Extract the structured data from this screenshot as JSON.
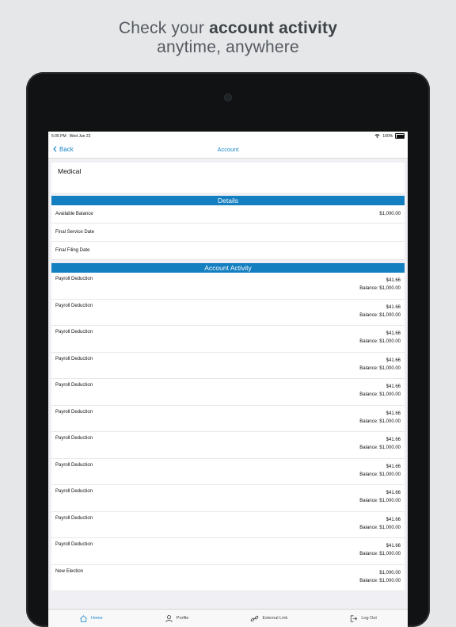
{
  "headline": {
    "line1_prefix": "Check your ",
    "line1_bold": "account activity",
    "line2": "anytime, anywhere"
  },
  "status_bar": {
    "time_date": "5:05 PM   Wed Jun 22",
    "battery": "100%"
  },
  "nav": {
    "back_label": "Back",
    "title": "Account"
  },
  "account": {
    "name": "Medical"
  },
  "details": {
    "header": "Details",
    "rows": [
      {
        "label": "Available Balance",
        "value": "$1,000.00"
      },
      {
        "label": "Final Service Date",
        "value": ""
      },
      {
        "label": "Final Filing Date",
        "value": ""
      }
    ]
  },
  "activity": {
    "header": "Account Activity",
    "rows": [
      {
        "label": "Payroll Deduction",
        "amount": "$41.66",
        "balance": "Balance: $1,000.00"
      },
      {
        "label": "Payroll Deduction",
        "amount": "$41.66",
        "balance": "Balance: $1,000.00"
      },
      {
        "label": "Payroll Deduction",
        "amount": "$41.66",
        "balance": "Balance: $1,000.00"
      },
      {
        "label": "Payroll Deduction",
        "amount": "$41.66",
        "balance": "Balance: $1,000.00"
      },
      {
        "label": "Payroll Deduction",
        "amount": "$41.66",
        "balance": "Balance: $1,000.00"
      },
      {
        "label": "Payroll Deduction",
        "amount": "$41.66",
        "balance": "Balance: $1,000.00"
      },
      {
        "label": "Payroll Deduction",
        "amount": "$41.66",
        "balance": "Balance: $1,000.00"
      },
      {
        "label": "Payroll Deduction",
        "amount": "$41.66",
        "balance": "Balance: $1,000.00"
      },
      {
        "label": "Payroll Deduction",
        "amount": "$41.66",
        "balance": "Balance: $1,000.00"
      },
      {
        "label": "Payroll Deduction",
        "amount": "$41.66",
        "balance": "Balance: $1,000.00"
      },
      {
        "label": "Payroll Deduction",
        "amount": "$41.66",
        "balance": "Balance: $1,000.00"
      },
      {
        "label": "New Election",
        "amount": "$1,000.00",
        "balance": "Balance: $1,000.00"
      }
    ]
  },
  "tabbar": {
    "items": [
      {
        "label": "Home",
        "icon": "home-icon",
        "active": true
      },
      {
        "label": "Profile",
        "icon": "profile-icon",
        "active": false
      },
      {
        "label": "External Link",
        "icon": "link-icon",
        "active": false
      },
      {
        "label": "Log Out",
        "icon": "logout-icon",
        "active": false
      }
    ]
  },
  "colors": {
    "accent": "#1b88c9",
    "section_header": "#137ec0",
    "device": "#111213",
    "background": "#e6e7e9"
  }
}
